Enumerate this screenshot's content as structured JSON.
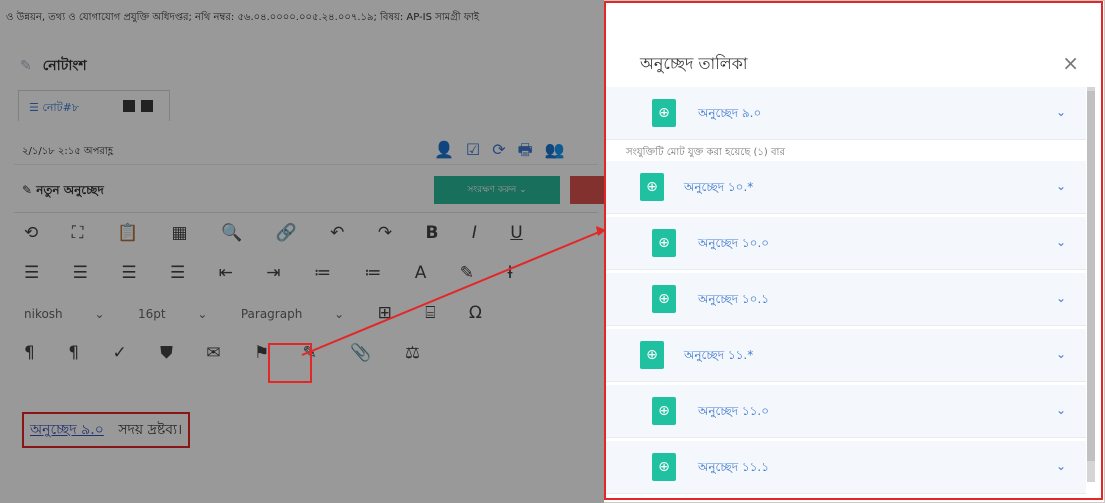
{
  "left": {
    "topline": "ও উন্নয়ন, তথ্য ও যোগাযোগ প্রযুক্তি অধিদপ্তর; নথি নম্বর: ৫৬.০৪.০০০০.০০৫.২৪.০০৭.১৯; বিষয়: AP-IS সামগ্রী ফাই",
    "panel_title": "নোটাংশ",
    "tab_label": "নোট#৮",
    "timestamp": "২/১/১৮ ২:১৫ অপরাহ্ণ",
    "new_para": "নতুন অনুচ্ছেদ",
    "save_button": "সংরক্ষণ করুন ⌄",
    "font_name": "nikosh",
    "font_size": "16pt",
    "paragraph": "Paragraph",
    "editor_link": "অনুচ্ছেদ ৯.০",
    "editor_text": "সদয় দ্রষ্টব্য।"
  },
  "modal": {
    "title": "অনুচ্ছেদ তালিকা",
    "close": "×",
    "items": [
      {
        "label": "অনুচ্ছেদ ৯.০"
      },
      {
        "label": "অনুচ্ছেদ ১০.*"
      },
      {
        "label": "অনুচ্ছেদ ১০.০"
      },
      {
        "label": "অনুচ্ছেদ ১০.১"
      },
      {
        "label": "অনুচ্ছেদ ১১.*"
      },
      {
        "label": "অনুচ্ছেদ ১১.০"
      },
      {
        "label": "অনুচ্ছেদ ১১.১"
      }
    ],
    "sub_note": "সংযুক্তিটি মোট যুক্ত করা হয়েছে (১) বার"
  },
  "colors": {
    "accent": "#20c1a1",
    "link": "#3f7bd1",
    "highlight": "#e32626"
  }
}
